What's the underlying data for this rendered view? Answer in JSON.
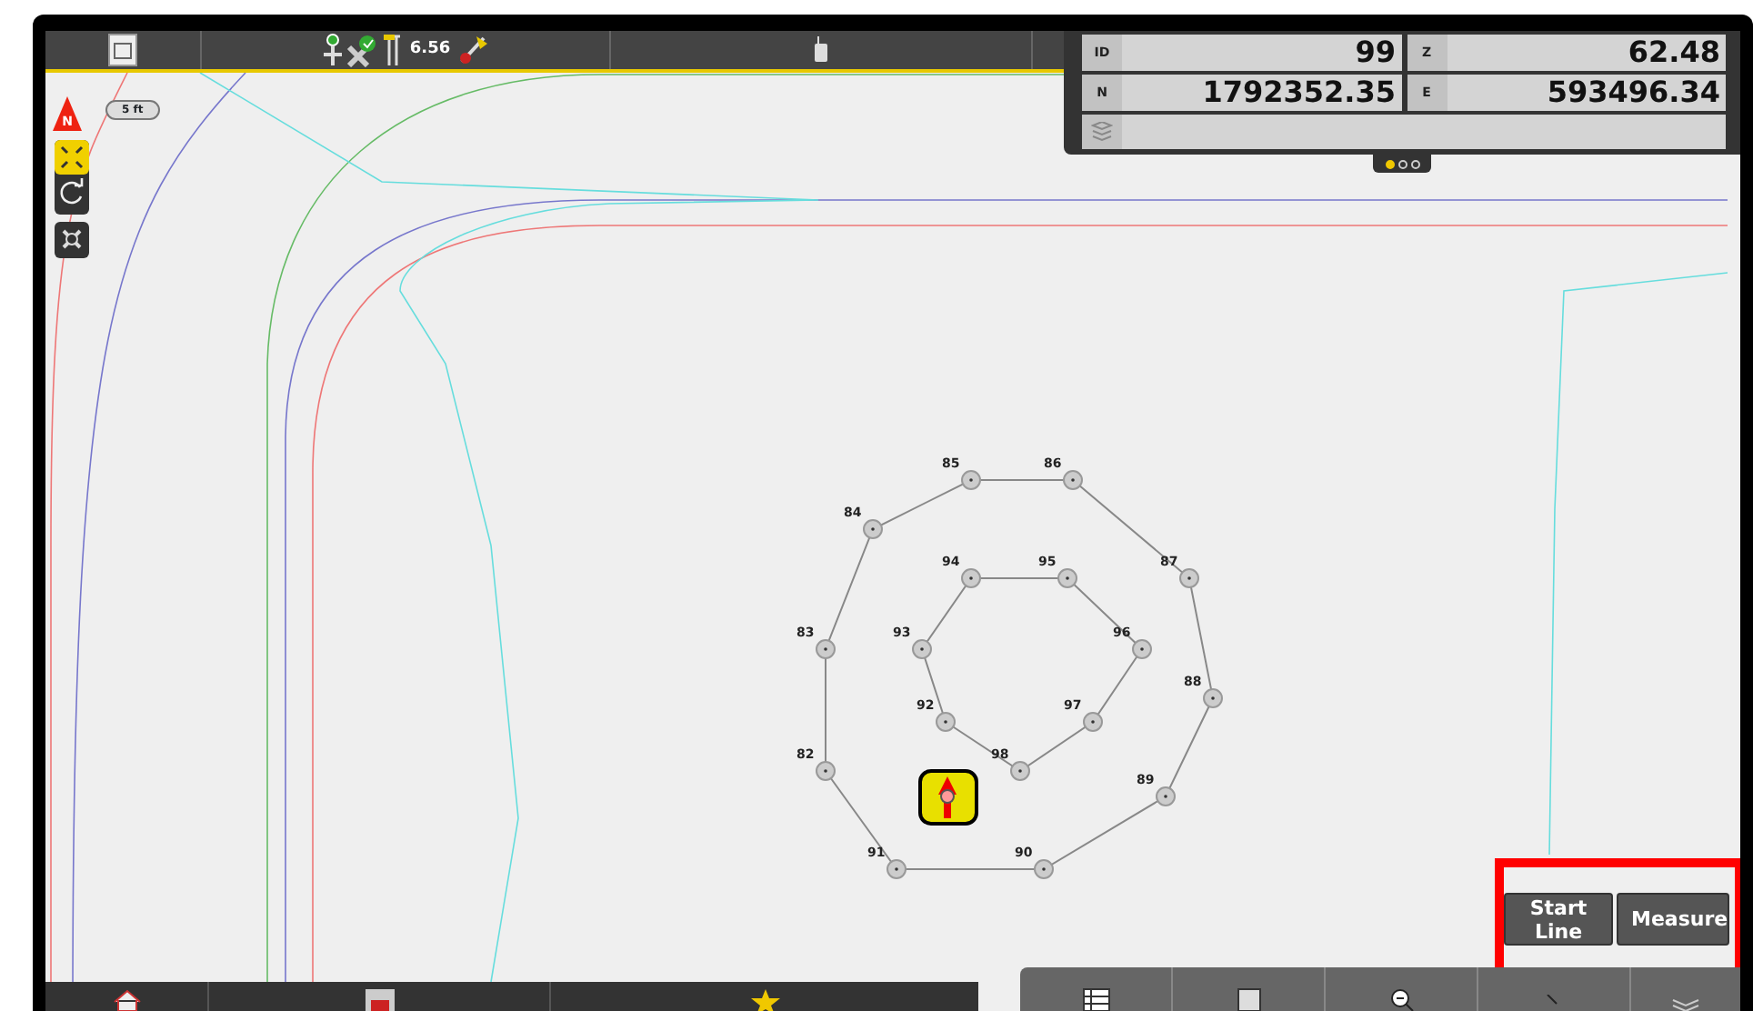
{
  "status_bar": {
    "height_reading": "6.56"
  },
  "map": {
    "north_label": "N",
    "scale_label": "5 ft",
    "points": [
      {
        "label": "82"
      },
      {
        "label": "83"
      },
      {
        "label": "84"
      },
      {
        "label": "85"
      },
      {
        "label": "86"
      },
      {
        "label": "87"
      },
      {
        "label": "88"
      },
      {
        "label": "89"
      },
      {
        "label": "90"
      },
      {
        "label": "91"
      },
      {
        "label": "92"
      },
      {
        "label": "93"
      },
      {
        "label": "94"
      },
      {
        "label": "95"
      },
      {
        "label": "96"
      },
      {
        "label": "97"
      },
      {
        "label": "98"
      }
    ]
  },
  "info_panel": {
    "fields": [
      {
        "label": "ID",
        "value": "99"
      },
      {
        "label": "Z",
        "value": "62.48"
      },
      {
        "label": "N",
        "value": "1792352.35"
      },
      {
        "label": "E",
        "value": "593496.34"
      }
    ],
    "pages": [
      {
        "selected": true
      },
      {
        "selected": false
      },
      {
        "selected": false
      }
    ]
  },
  "actions": [
    {
      "label": "Start Line"
    },
    {
      "label": "Measure"
    }
  ]
}
